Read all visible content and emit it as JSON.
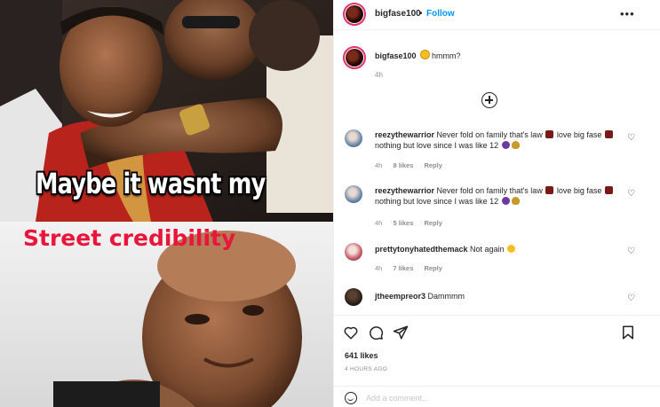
{
  "meme": {
    "top_text": "Maybe it wasnt my",
    "bottom_text": "Street credibility",
    "bottom_color": "#e8163a"
  },
  "post": {
    "username": "bigfase100",
    "separator": "•",
    "follow_label": "Follow",
    "more_icon": "more-horizontal-icon",
    "caption_text": "hmmm?",
    "caption_time": "4h",
    "likes": "641 likes",
    "posted": "4 HOURS AGO",
    "add_comment_placeholder": "Add a comment..."
  },
  "comments": [
    {
      "user": "reezythewarrior",
      "text_1": "Never fold on family that's law",
      "text_2": "love big",
      "text_3": "fase",
      "text_4": "nothing but love since I was like 12",
      "time": "4h",
      "likes": "8 likes",
      "reply": "Reply"
    },
    {
      "user": "reezythewarrior",
      "text_1": "Never fold on family that's law",
      "text_2": "love big",
      "text_3": "fase",
      "text_4": "nothing but love since I was like 12",
      "time": "4h",
      "likes": "5 likes",
      "reply": "Reply"
    },
    {
      "user": "prettytonyhatedthemack",
      "text_1": "Not again",
      "time": "4h",
      "likes": "7 likes",
      "reply": "Reply"
    },
    {
      "user": "jtheempreor3",
      "text_1": "Dammmm"
    }
  ],
  "colors": {
    "link_blue": "#0095f6",
    "meta_gray": "#8e8e8e",
    "text": "#262626"
  }
}
